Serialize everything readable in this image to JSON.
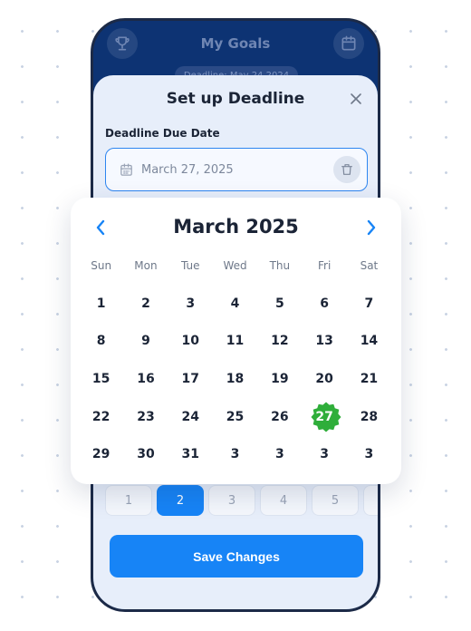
{
  "header": {
    "title": "My Goals",
    "deadline_pill": "Deadline: May 24 2024"
  },
  "sheet": {
    "title": "Set up Deadline",
    "field_label": "Deadline Due Date",
    "date_value": "March 27, 2025",
    "save_label": "Save Changes"
  },
  "calendar": {
    "month_label": "March 2025",
    "weekdays": [
      "Sun",
      "Mon",
      "Tue",
      "Wed",
      "Thu",
      "Fri",
      "Sat"
    ],
    "days": [
      "1",
      "2",
      "3",
      "4",
      "5",
      "6",
      "7",
      "8",
      "9",
      "10",
      "11",
      "12",
      "13",
      "14",
      "15",
      "16",
      "17",
      "18",
      "19",
      "20",
      "21",
      "22",
      "23",
      "24",
      "25",
      "26",
      "27",
      "28",
      "29",
      "30",
      "31",
      "3",
      "3",
      "3",
      "3"
    ],
    "selected_day": "27"
  },
  "steps": [
    "1",
    "2",
    "3",
    "4",
    "5",
    ""
  ],
  "active_step": "2",
  "colors": {
    "accent": "#1784f6",
    "selected": "#2fae3a",
    "header_bg": "#0d3373",
    "sheet_bg": "#e7eefa"
  },
  "icons": {
    "header_left": "trophy-icon",
    "header_right": "calendar-icon",
    "close": "close-icon",
    "input": "calendar-icon",
    "clear": "trash-icon",
    "prev": "chevron-left-icon",
    "next": "chevron-right-icon"
  }
}
